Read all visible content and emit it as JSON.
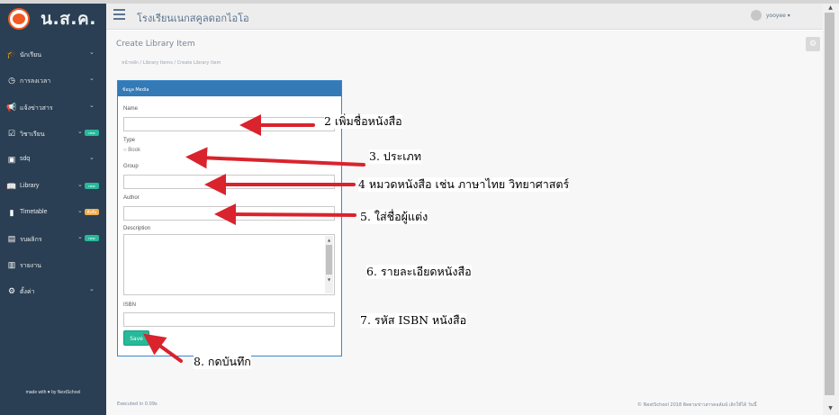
{
  "sidebar": {
    "brand": "น.ส.ค.",
    "items": [
      {
        "icon": "graduation-icon",
        "label": "นักเรียน"
      },
      {
        "icon": "clock-icon",
        "label": "การลงเวลา"
      },
      {
        "icon": "megaphone-icon",
        "label": "แจ้งข่าวสาร"
      },
      {
        "icon": "calendar-check-icon",
        "label": "วิชาเรียน"
      },
      {
        "icon": "grid-icon",
        "label": "sdq"
      },
      {
        "icon": "book-icon",
        "label": "Library",
        "badge": "new",
        "badge_color": "#26b99a"
      },
      {
        "icon": "phone-icon",
        "label": "Timetable",
        "badge": "คือขั้น",
        "badge_color": "#f0ad4e"
      },
      {
        "icon": "score-icon",
        "label": "รบผลิกร",
        "badge": "new",
        "badge_color": "#26b99a"
      },
      {
        "icon": "bar-chart-icon",
        "label": "รายงาน"
      },
      {
        "icon": "settings-icon",
        "label": "ตั้งค่า"
      }
    ],
    "made_with": "made with ♥ by NextSchool"
  },
  "header": {
    "school_name": "โรงเรียนเนกสคูลดอกไอโอ",
    "username": "yooyee ▾"
  },
  "main": {
    "page_title": "Create Library Item",
    "breadcrumb": "หน้าหลัก / Library Items / Create Library Item"
  },
  "form": {
    "panel_title": "ข้อมูล Media",
    "name_label": "Name",
    "type_label": "Type",
    "type_option": "Book",
    "group_label": "Group",
    "author_label": "Author",
    "description_label": "Description",
    "isbn_label": "ISBN",
    "save_label": "Save"
  },
  "footer": {
    "left": "Executed in 0.09s",
    "right": "© NextSchool 2018 ติดตามข่าวสารคอลัมน์ เลิกใช้ได้ วันนี้"
  },
  "callouts": {
    "c2": "2 เพิ่มชื่อหนังสือ",
    "c3": "3. ประเภท",
    "c4": "4 หมวดหนังสือ เช่น ภาษาไทย วิทยาศาสตร์",
    "c5": "5. ใส่ชื่อผู้แต่ง",
    "c6": "6. รายละเอียดหนังสือ",
    "c7": "7. รหัส ISBN หนังสือ",
    "c8": "8. กดบันทึก"
  },
  "colors": {
    "arrow": "#d9232d",
    "sidebar": "#2a3f54",
    "panel_header": "#337ab7",
    "save_button": "#26b99a"
  }
}
